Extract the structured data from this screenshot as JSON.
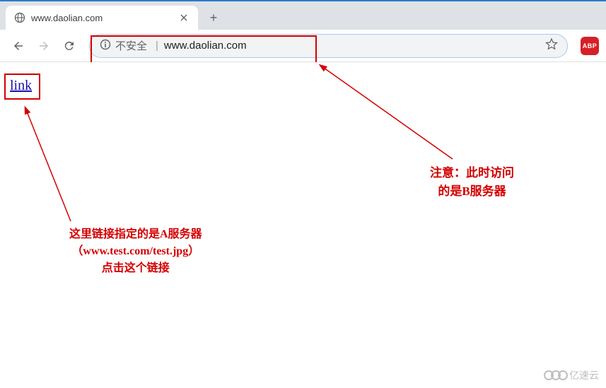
{
  "tab": {
    "title": "www.daolian.com"
  },
  "omnibox": {
    "warning": "不安全",
    "url": "www.daolian.com"
  },
  "page": {
    "link_text": "link"
  },
  "annotations": {
    "left_line1": "这里链接指定的是A服务器",
    "left_line2": "（www.test.com/test.jpg）",
    "left_line3": "点击这个链接",
    "right_line1": "注意：此时访问",
    "right_line2": "的是B服务器"
  },
  "watermark": {
    "text": "亿速云"
  }
}
